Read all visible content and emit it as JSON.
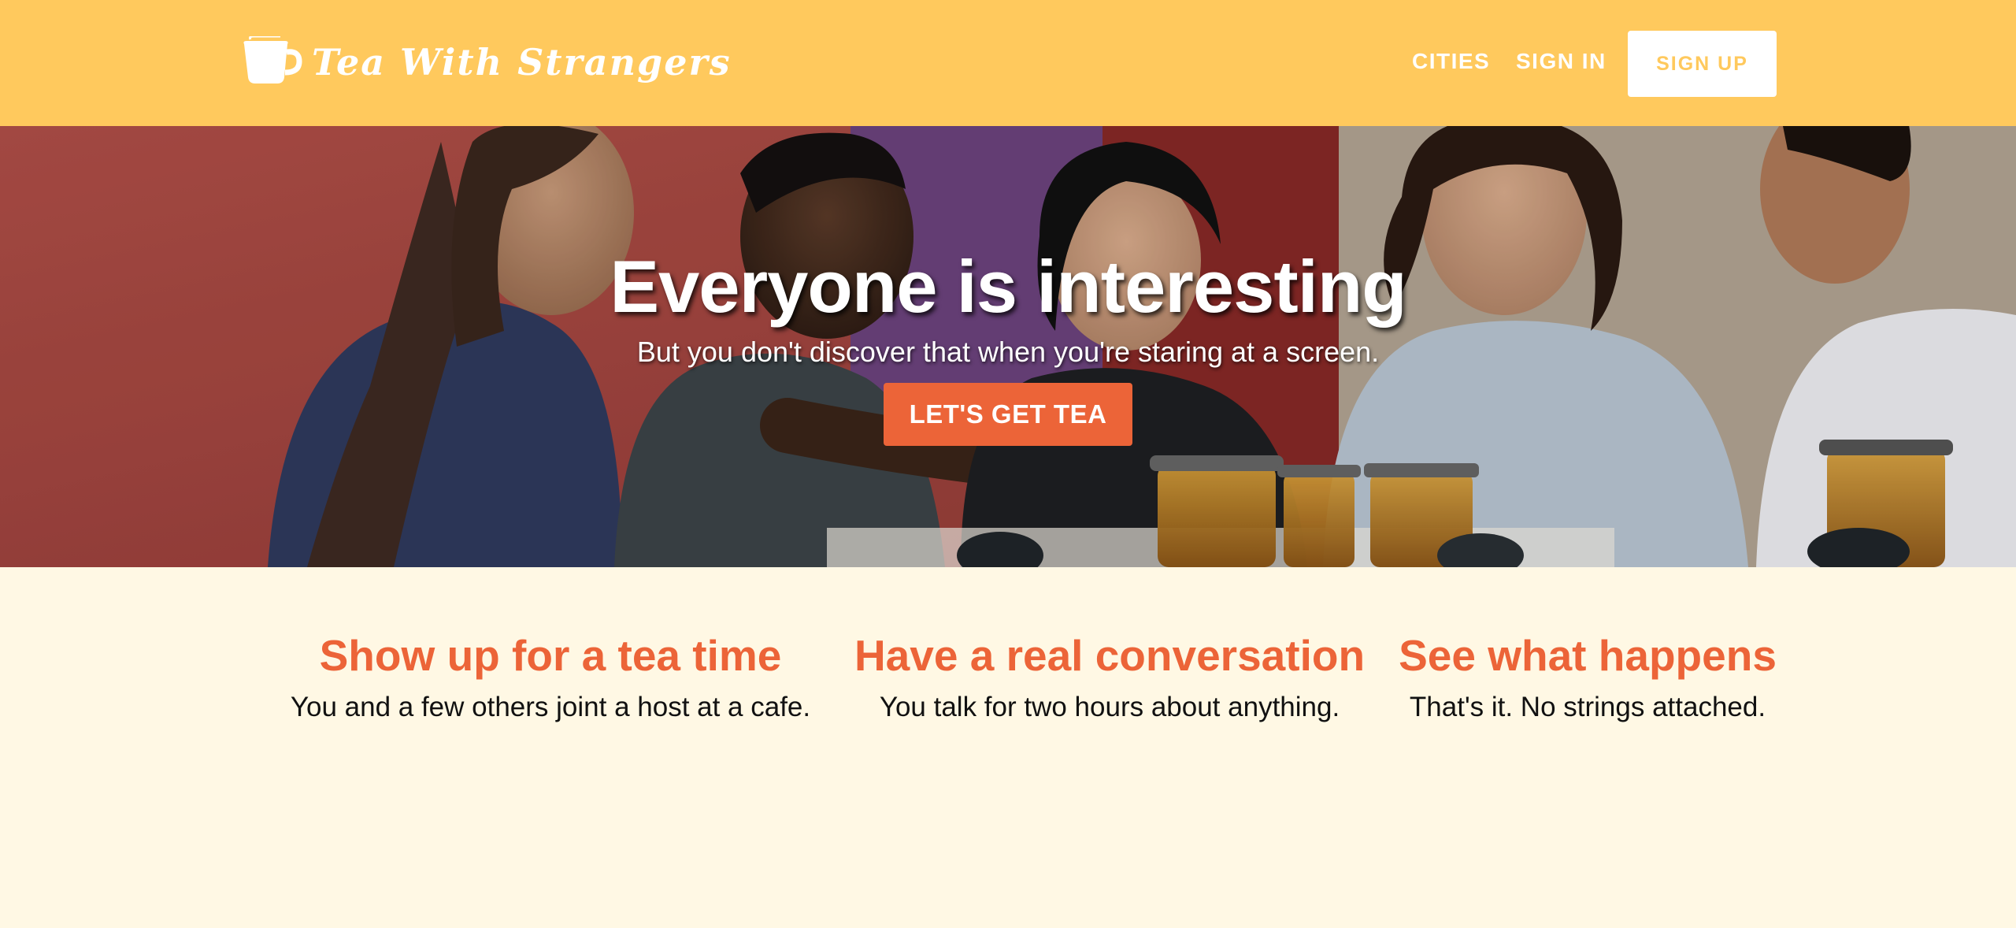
{
  "header": {
    "logo_text": "Tea With Strangers",
    "nav": {
      "cities": "CITIES",
      "sign_in": "SIGN IN",
      "sign_up": "SIGN UP"
    }
  },
  "hero": {
    "title": "Everyone is interesting",
    "subtitle": "But you don't discover that when you're staring at a screen.",
    "cta": "LET'S GET TEA"
  },
  "features": [
    {
      "title": "Show up for a tea time",
      "text": "You and a few others joint a host at a cafe."
    },
    {
      "title": "Have a real conversation",
      "text": "You talk for two hours about anything."
    },
    {
      "title": "See what happens",
      "text": "That's it. No strings attached."
    }
  ],
  "colors": {
    "header_bg": "#ffc95d",
    "accent": "#ec6438",
    "page_bg": "#fff8e4"
  }
}
